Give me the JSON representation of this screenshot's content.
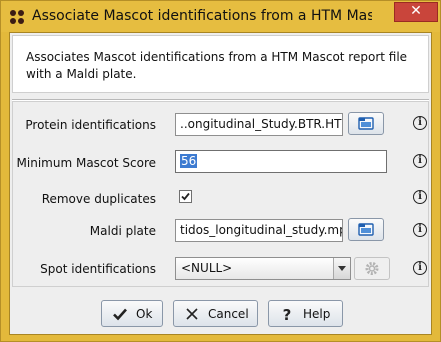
{
  "window": {
    "title": "Associate Mascot identifications from a HTM Mascot r...",
    "close_symbol": "✕"
  },
  "description": "Associates Mascot identifications from a HTM Mascot report file with a Maldi plate.",
  "fields": {
    "protein": {
      "label": "Protein identifications",
      "value": "..ongitudinal_Study.BTR.HTM"
    },
    "score": {
      "label": "Minimum Mascot Score",
      "value": "56"
    },
    "duplicates": {
      "label": "Remove duplicates",
      "checked": true
    },
    "maldi": {
      "label": "Maldi plate",
      "value": "tidos_longitudinal_study.mpl"
    },
    "spots": {
      "label": "Spot identifications",
      "value": "<NULL>"
    }
  },
  "info_glyph": "i",
  "buttons": {
    "ok": "Ok",
    "cancel": "Cancel",
    "help": "Help"
  },
  "colors": {
    "titlebar": "#e6bd40",
    "close": "#c9453b",
    "selection": "#3d7bd1"
  }
}
